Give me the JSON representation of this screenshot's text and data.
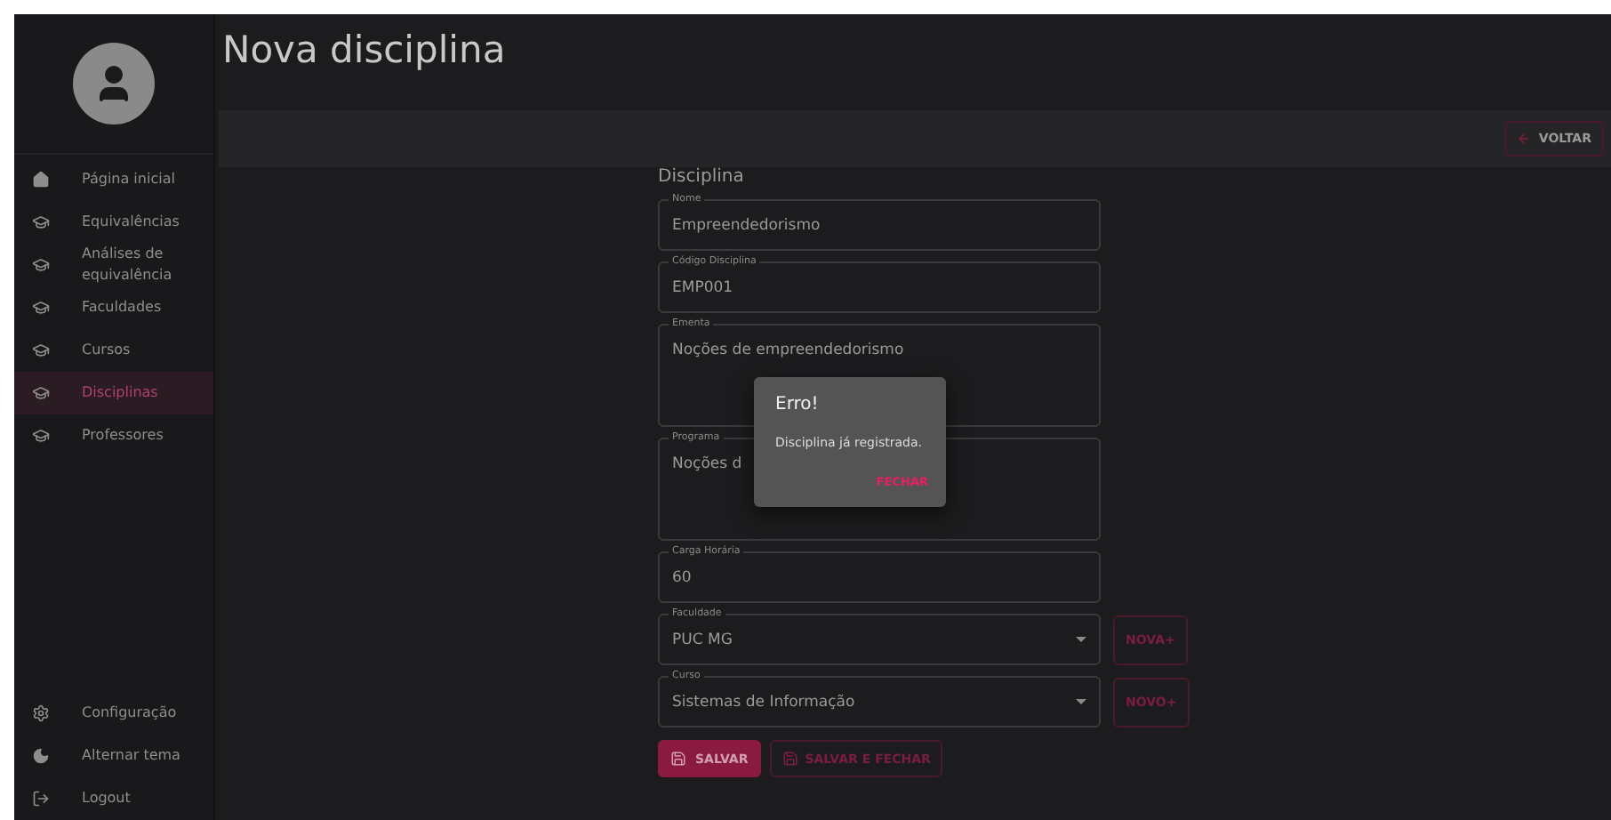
{
  "page": {
    "title": "Nova disciplina"
  },
  "toolbar": {
    "back_button": "VOLTAR"
  },
  "sidebar": {
    "items": [
      {
        "label": "Página inicial",
        "selected": false
      },
      {
        "label": "Equivalências",
        "selected": false
      },
      {
        "label": "Análises de equivalência",
        "selected": false
      },
      {
        "label": "Faculdades",
        "selected": false
      },
      {
        "label": "Cursos",
        "selected": false
      },
      {
        "label": "Disciplinas",
        "selected": true
      },
      {
        "label": "Professores",
        "selected": false
      }
    ],
    "bottom_items": [
      {
        "label": "Configuração"
      },
      {
        "label": "Alternar tema"
      },
      {
        "label": "Logout"
      }
    ]
  },
  "form": {
    "heading": "Disciplina",
    "fields": [
      {
        "kind": "text",
        "label": "Nome",
        "value": "Empreendedorismo"
      },
      {
        "kind": "text",
        "label": "Código Disciplina",
        "value": "EMP001"
      },
      {
        "kind": "area",
        "label": "Ementa",
        "value": "Noções de empreendedorismo"
      },
      {
        "kind": "area",
        "label": "Programa",
        "value": "Noções d"
      },
      {
        "kind": "text",
        "label": "Carga Horária",
        "value": "60"
      },
      {
        "kind": "select",
        "label": "Faculdade",
        "value": "PUC MG",
        "add_button": "NOVA+"
      },
      {
        "kind": "select",
        "label": "Curso",
        "value": "Sistemas de Informação",
        "add_button": "NOVO+"
      }
    ],
    "buttons": [
      {
        "label": "SALVAR",
        "kind": "filled"
      },
      {
        "label": "SALVAR E FECHAR",
        "kind": "outlined"
      }
    ]
  },
  "dialog": {
    "title": "Erro!",
    "message": "Disciplina já registrada.",
    "button": "FECHAR"
  }
}
